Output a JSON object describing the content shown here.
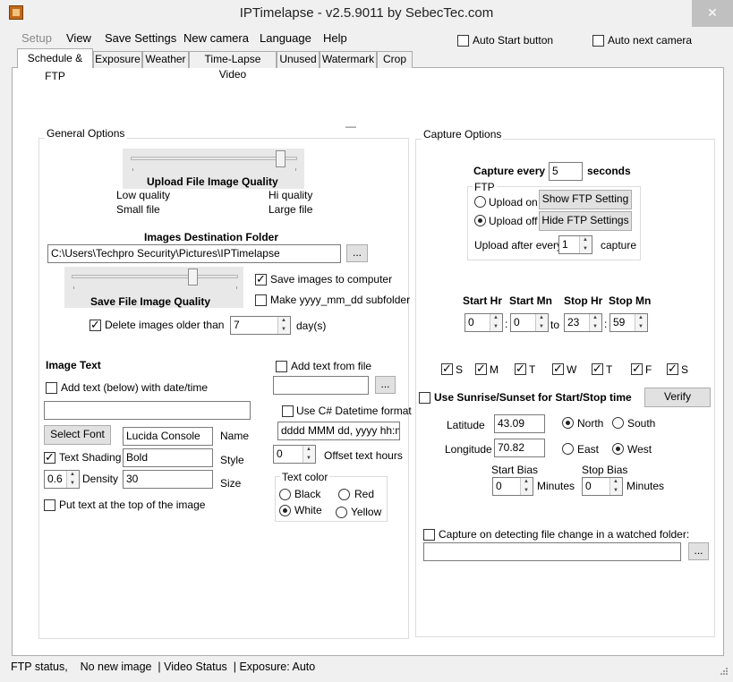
{
  "window": {
    "title": "IPTimelapse - v2.5.9011 by SebecTec.com",
    "close_glyph": "✕"
  },
  "menu": [
    "Setup",
    "View",
    "Save Settings",
    "New camera",
    "Language",
    "Help"
  ],
  "top_checks": {
    "auto_start_button": {
      "label": "Auto Start button",
      "checked": false
    },
    "auto_next_camera": {
      "label": "Auto next camera",
      "checked": false
    }
  },
  "tabs": [
    "Schedule & FTP",
    "Exposure",
    "Weather",
    "Time-Lapse Video",
    "Unused",
    "Watermark",
    "Crop"
  ],
  "active_tab": "Schedule & FTP",
  "misc": {
    "dash": "—"
  },
  "general": {
    "group_title": "General Options",
    "upload_quality": {
      "title": "Upload File Image Quality",
      "level": 0.95,
      "low": "Low quality",
      "high": "Hi quality",
      "small": "Small file",
      "large": "Large file"
    },
    "dest_folder": {
      "title": "Images Destination Folder",
      "path": "C:\\Users\\Techpro Security\\Pictures\\IPTimelapse",
      "browse": "..."
    },
    "save_quality": {
      "title": "Save File Image Quality",
      "level": 0.72
    },
    "save_to_computer": {
      "label": "Save images to computer",
      "checked": true
    },
    "subfolder": {
      "label": "Make yyyy_mm_dd subfolder",
      "checked": false
    },
    "delete_older": {
      "label": "Delete images older than",
      "checked": true,
      "value": "7",
      "unit": "day(s)"
    },
    "image_text": {
      "title": "Image Text",
      "add_text": {
        "label": "Add text (below) with date/time",
        "checked": false
      },
      "text_value": "",
      "select_font": "Select Font",
      "font_name": "Lucida Console",
      "name_label": "Name",
      "text_shading": {
        "label": "Text Shading",
        "checked": true
      },
      "style_value": "Bold",
      "style_label": "Style",
      "density_value": "0.6",
      "density_label": "Density",
      "size_value": "30",
      "size_label": "Size",
      "put_top": {
        "label": "Put text at the top of the image",
        "checked": false
      },
      "add_from_file": {
        "label": "Add text from file",
        "checked": false
      },
      "file_value": "",
      "file_browse": "...",
      "use_csharp": {
        "label": "Use C# Datetime format",
        "checked": false
      },
      "datetime_format": "dddd MMM dd, yyyy  hh:mm",
      "offset_value": "0",
      "offset_label": "Offset text hours",
      "text_color": {
        "title": "Text color",
        "options": [
          "Black",
          "Red",
          "White",
          "Yellow"
        ],
        "selected": "White"
      }
    }
  },
  "capture": {
    "group_title": "Capture Options",
    "capture_every_label": "Capture every",
    "capture_every_value": "5",
    "seconds_label": "seconds",
    "ftp": {
      "title": "FTP",
      "upload_on": "Upload on",
      "upload_off": "Upload off",
      "selected": "Upload off",
      "show_button": "Show  FTP Setting",
      "hide_button": "Hide FTP Settings",
      "upload_after_label": "Upload after every",
      "upload_after_value": "1",
      "capture_label": "capture"
    },
    "schedule": {
      "headers": [
        "Start Hr",
        "Start Mn",
        "Stop Hr",
        "Stop Mn"
      ],
      "start_hr": "0",
      "start_mn": "0",
      "stop_hr": "23",
      "stop_mn": "59",
      "colon": ":",
      "to": "to"
    },
    "days": [
      {
        "label": "S",
        "checked": true
      },
      {
        "label": "M",
        "checked": true
      },
      {
        "label": "T",
        "checked": true
      },
      {
        "label": "W",
        "checked": true
      },
      {
        "label": "T",
        "checked": true
      },
      {
        "label": "F",
        "checked": true
      },
      {
        "label": "S",
        "checked": true
      }
    ],
    "sunrise": {
      "label": "Use Sunrise/Sunset for Start/Stop time",
      "checked": false,
      "verify": "Verify",
      "latitude_label": "Latitude",
      "latitude": "43.09",
      "north": "North",
      "south": "South",
      "ns_selected": "North",
      "longitude_label": "Longitude",
      "longitude": "70.82",
      "east": "East",
      "west": "West",
      "ew_selected": "West",
      "start_bias_label": "Start Bias",
      "start_bias": "0",
      "stop_bias_label": "Stop Bias",
      "stop_bias": "0",
      "minutes": "Minutes"
    },
    "watched": {
      "label": "Capture on detecting file change in a watched folder:",
      "checked": false,
      "path": "",
      "browse": "..."
    }
  },
  "status": {
    "text": "FTP status,    No new image  | Video Status  | Exposure: Auto"
  }
}
